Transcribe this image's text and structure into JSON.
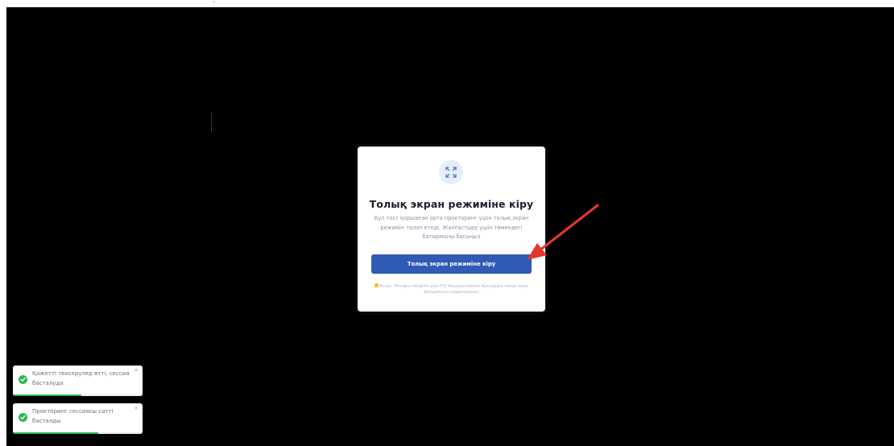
{
  "colors": {
    "backdrop": "#000000",
    "accent": "#2f5bb7",
    "success": "#2fb850",
    "annotation_arrow": "#e2372b",
    "icon_bg": "#e6eef9"
  },
  "modal": {
    "icon": "fullscreen-expand-icon",
    "title": "Толық экран режиміне кіру",
    "description": "Бұл тест қоршаған орта прокторинг үшін толық экран режимін талап етеді. Жалғастыру үшін төмендегі батырманы басыңыз",
    "button_label": "Толық экран режиміне кіру",
    "note_icon": "warning-icon",
    "note": "Кеңес: Жоғары тиімділік үшін F11 басыңыз немесе браузердің толық экран батырмасын пайдаланыңыз"
  },
  "toasts": [
    {
      "icon": "check-circle-icon",
      "message": "Қажетті тексерулер өтті, сессия басталуда",
      "close_label": "×",
      "progress": 0.53
    },
    {
      "icon": "check-circle-icon",
      "message": "Прокторинг сессиясы сәтті басталды",
      "close_label": "×",
      "progress": 0.66
    }
  ]
}
